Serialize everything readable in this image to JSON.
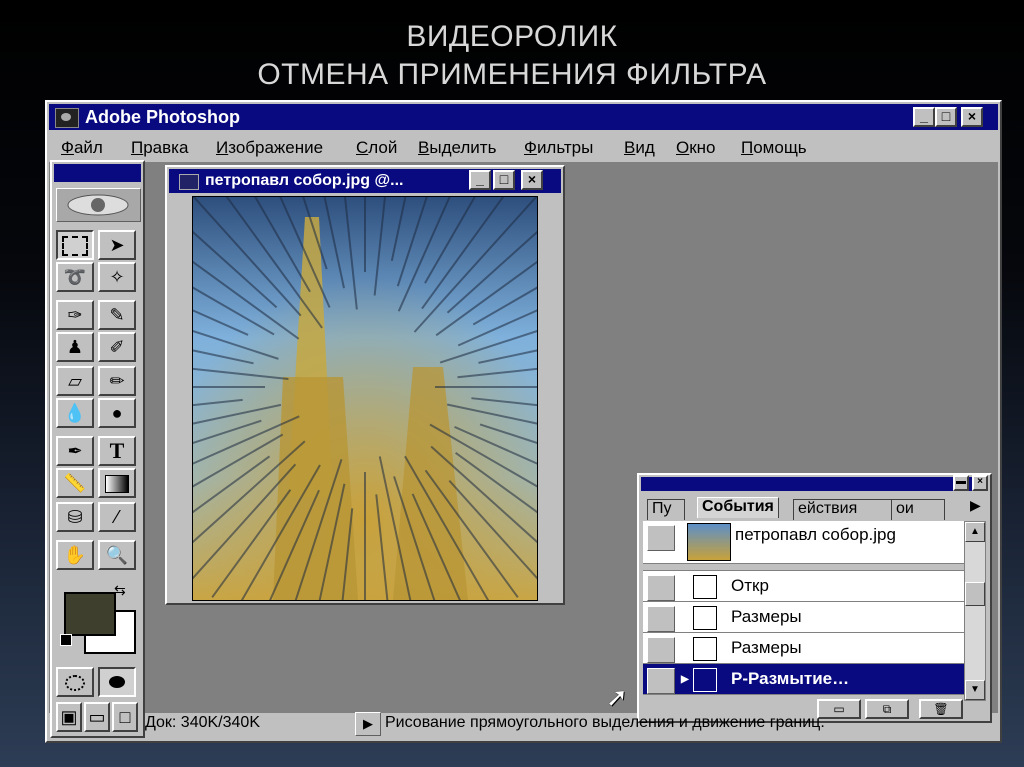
{
  "slide": {
    "line1": "ВИДЕОРОЛИК",
    "line2": "ОТМЕНА ПРИМЕНЕНИЯ ФИЛЬТРА"
  },
  "app": {
    "title": "Adobe Photoshop",
    "menu": [
      "Файл",
      "Правка",
      "Изображение",
      "Слой",
      "Выделить",
      "Фильтры",
      "Вид",
      "Окно",
      "Помощь"
    ]
  },
  "document": {
    "title": "петропавл собор.jpg @..."
  },
  "toolbox": {
    "tools": [
      "marquee-icon",
      "move-icon",
      "lasso-icon",
      "magic-wand-icon",
      "airbrush-icon",
      "paintbrush-icon",
      "rubber-stamp-icon",
      "history-brush-icon",
      "eraser-icon",
      "pencil-icon",
      "blur-icon",
      "burn-icon",
      "pen-icon",
      "type-icon",
      "measure-icon",
      "gradient-icon",
      "paint-bucket-icon",
      "eyedropper-icon",
      "hand-icon",
      "zoom-icon"
    ],
    "foreground_color": "#3f3f2e",
    "background_color": "#ffffff"
  },
  "history": {
    "tabs": [
      "Пу",
      "События",
      "ействия",
      "ои"
    ],
    "snapshot": "петропавл собор.jpg",
    "steps": [
      "Откр",
      "Размеры",
      "Размеры",
      "Р-Размытие…"
    ],
    "selected_index": 3
  },
  "status": {
    "doc": "Док: 340K/340K",
    "message": "Рисование прямоугольного выделения и движение границ."
  }
}
